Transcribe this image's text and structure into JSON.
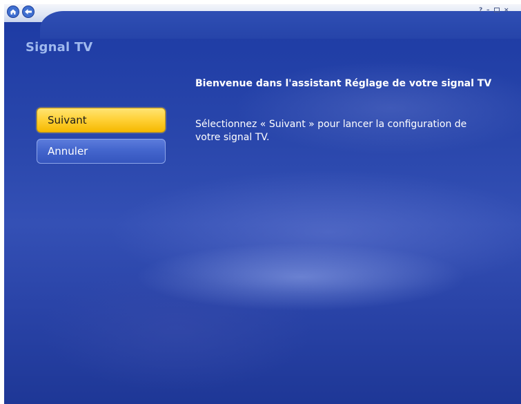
{
  "titlebar": {
    "home_icon": "home-icon",
    "back_icon": "back-arrow-icon",
    "help_glyph": "?",
    "minimize_glyph": "–",
    "close_glyph": "×"
  },
  "page": {
    "title": "Signal TV",
    "heading": "Bienvenue dans l'assistant Réglage de votre signal TV",
    "body": "Sélectionnez « Suivant » pour lancer la configuration de votre signal TV."
  },
  "buttons": {
    "next_label": "Suivant",
    "cancel_label": "Annuler"
  },
  "colors": {
    "background": "#2a47ac",
    "title": "#9fb9ee",
    "next_button": "#ffd23a",
    "cancel_button": "#4466cd"
  }
}
